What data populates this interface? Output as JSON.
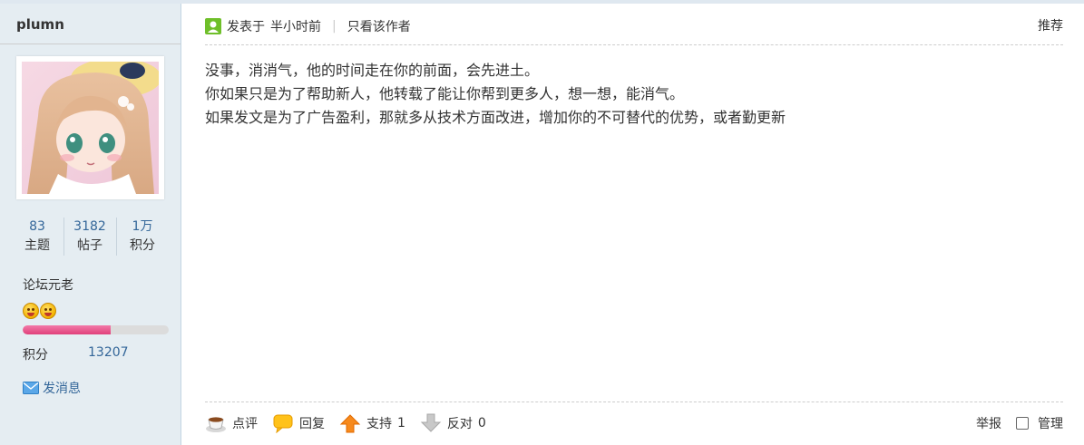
{
  "author": {
    "username": "plumn",
    "stats": [
      {
        "value": "83",
        "label": "主题"
      },
      {
        "value": "3182",
        "label": "帖子"
      },
      {
        "value": "1万",
        "label": "积分"
      }
    ],
    "rank": "论坛元老",
    "level_progress": 0.6,
    "points_label": "积分",
    "points_value": "13207",
    "send_message": "发消息"
  },
  "post": {
    "posted_prefix": "发表于",
    "posted_time": "半小时前",
    "separator": "|",
    "only_author": "只看该作者",
    "recommend": "推荐",
    "content_lines": [
      "没事，消消气，他的时间走在你的前面，会先进土。",
      "你如果只是为了帮助新人，他转载了能让你帮到更多人，想一想，能消气。",
      "如果发文是为了广告盈利，那就多从技术方面改进，增加你的不可替代的优势，或者勤更新"
    ]
  },
  "actions": {
    "comment": "点评",
    "reply": "回复",
    "support": "支持",
    "support_count": "1",
    "oppose": "反对",
    "oppose_count": "0",
    "report": "举报",
    "manage": "管理"
  },
  "colors": {
    "sidebar_bg": "#e5edf2",
    "link_blue": "#336699",
    "progress_pink": "#e0407a",
    "divider": "#cdcdcd"
  },
  "icons": {
    "author": "user-icon",
    "message": "envelope-icon",
    "comment": "coffee-cup-icon",
    "reply": "speech-bubble-icon",
    "support": "arrow-up-icon",
    "oppose": "arrow-down-icon",
    "medal": "smiley-medal-icon"
  }
}
